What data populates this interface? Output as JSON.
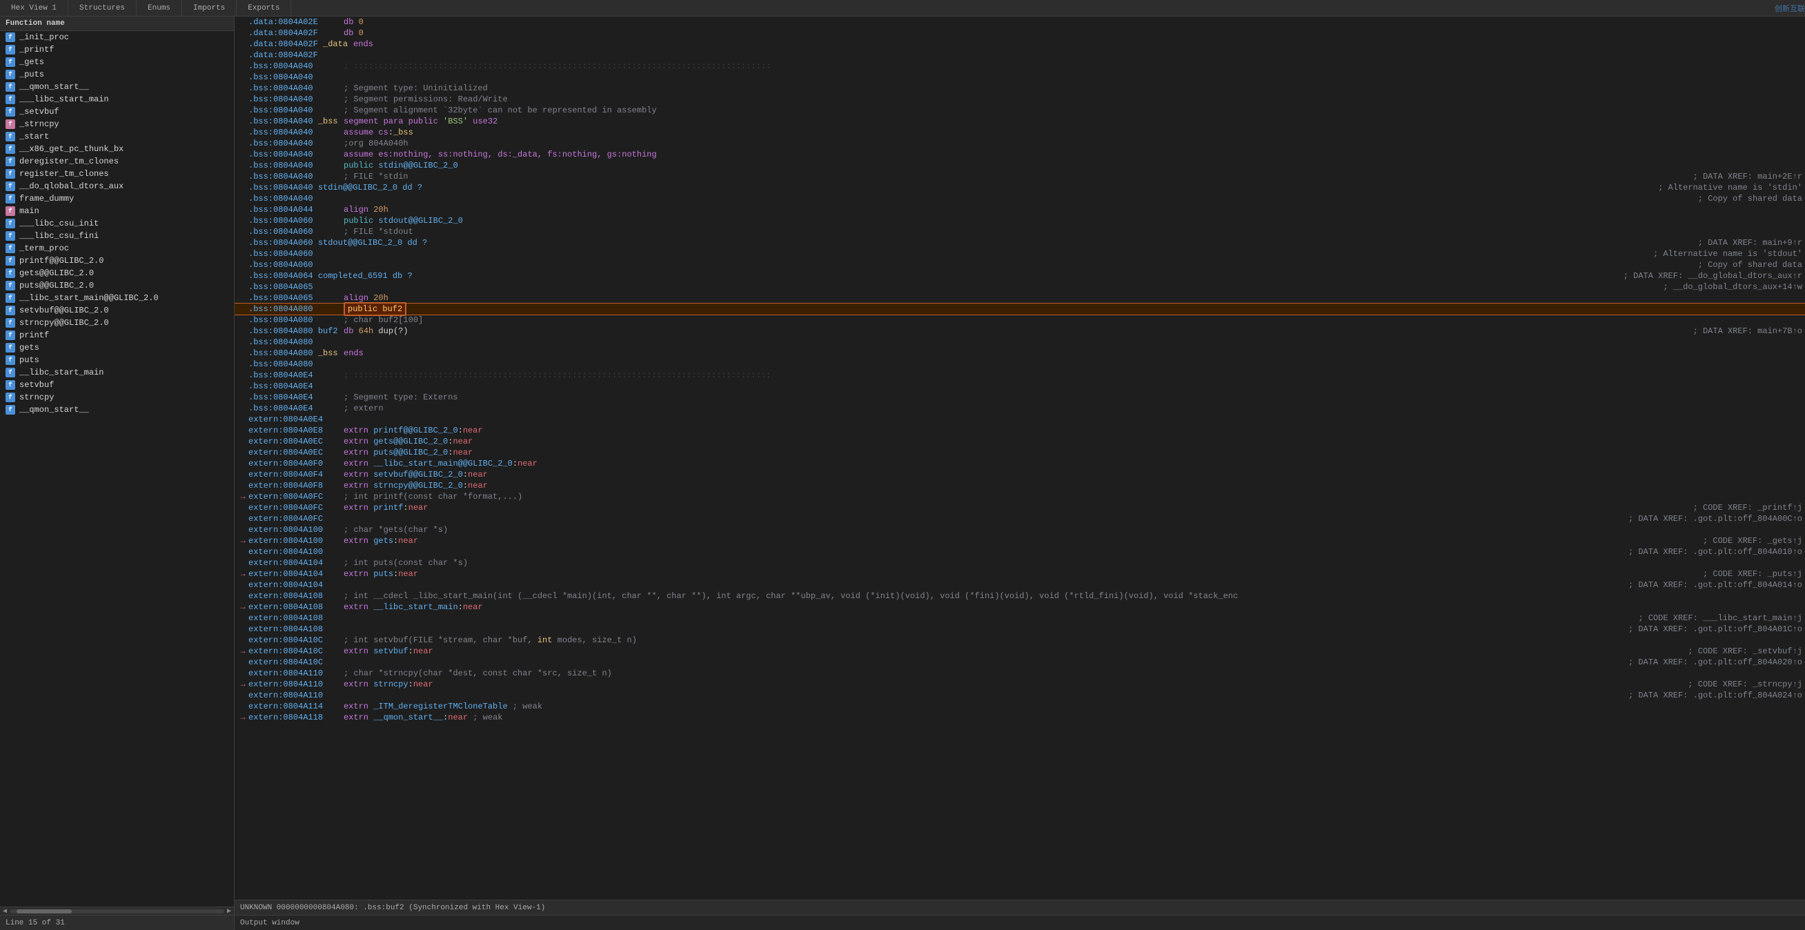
{
  "tabs": [
    {
      "label": "Hex View 1",
      "active": false
    },
    {
      "label": "Structures",
      "active": false
    },
    {
      "label": "Enums",
      "active": false
    },
    {
      "label": "Imports",
      "active": false
    },
    {
      "label": "Exports",
      "active": false
    }
  ],
  "left_panel": {
    "header": "Function name",
    "functions": [
      {
        "name": "_init_proc",
        "icon": "blue",
        "selected": false
      },
      {
        "name": "_printf",
        "icon": "blue",
        "selected": false
      },
      {
        "name": "_gets",
        "icon": "blue",
        "selected": false
      },
      {
        "name": "_puts",
        "icon": "blue",
        "selected": false
      },
      {
        "name": "__qmon_start__",
        "icon": "blue",
        "selected": false
      },
      {
        "name": "___libc_start_main",
        "icon": "blue",
        "selected": false
      },
      {
        "name": "_setvbuf",
        "icon": "blue",
        "selected": false
      },
      {
        "name": "_strncpy",
        "icon": "pink",
        "selected": false
      },
      {
        "name": "_start",
        "icon": "blue",
        "selected": false
      },
      {
        "name": "__x86_get_pc_thunk_bx",
        "icon": "blue",
        "selected": false
      },
      {
        "name": "deregister_tm_clones",
        "icon": "blue",
        "selected": false
      },
      {
        "name": "register_tm_clones",
        "icon": "blue",
        "selected": false
      },
      {
        "name": "__do_qlobal_dtors_aux",
        "icon": "blue",
        "selected": false
      },
      {
        "name": "frame_dummy",
        "icon": "blue",
        "selected": false
      },
      {
        "name": "main",
        "icon": "pink",
        "selected": false
      },
      {
        "name": "___libc_csu_init",
        "icon": "blue",
        "selected": false
      },
      {
        "name": "___libc_csu_fini",
        "icon": "blue",
        "selected": false
      },
      {
        "name": "_term_proc",
        "icon": "blue",
        "selected": false
      },
      {
        "name": "printf@@GLIBC_2.0",
        "icon": "blue",
        "selected": false
      },
      {
        "name": "gets@@GLIBC_2.0",
        "icon": "blue",
        "selected": false
      },
      {
        "name": "puts@@GLIBC_2.0",
        "icon": "blue",
        "selected": false
      },
      {
        "name": "__libc_start_main@@GLIBC_2.0",
        "icon": "blue",
        "selected": false
      },
      {
        "name": "setvbuf@@GLIBC_2.0",
        "icon": "blue",
        "selected": false
      },
      {
        "name": "strncpy@@GLIBC_2.0",
        "icon": "blue",
        "selected": false
      },
      {
        "name": "printf",
        "icon": "blue",
        "selected": false
      },
      {
        "name": "gets",
        "icon": "blue",
        "selected": false
      },
      {
        "name": "puts",
        "icon": "blue",
        "selected": false
      },
      {
        "name": "__libc_start_main",
        "icon": "blue",
        "selected": false
      },
      {
        "name": "setvbuf",
        "icon": "blue",
        "selected": false
      },
      {
        "name": "strncpy",
        "icon": "blue",
        "selected": false
      },
      {
        "name": "__qmon_start__",
        "icon": "blue",
        "selected": false
      }
    ],
    "status": "Line 15 of 31"
  },
  "code_lines": [
    {
      "addr": ".data:0804A02E",
      "content": "db  0",
      "comment": "",
      "arrow": false
    },
    {
      "addr": ".data:0804A02F",
      "content": "db  0",
      "comment": "",
      "arrow": false
    },
    {
      "addr": ".data:0804A02F  _data",
      "content": "ends",
      "comment": "",
      "arrow": false
    },
    {
      "addr": ".data:0804A02F",
      "content": "",
      "comment": "",
      "arrow": false
    },
    {
      "addr": ".bss:0804A040",
      "content": "; ::::::::::::::::::::::::::::::::::::::::::::::::::::::::::::::::::::::::::::::::::::",
      "comment": "",
      "arrow": false
    },
    {
      "addr": ".bss:0804A040",
      "content": "",
      "comment": "",
      "arrow": false
    },
    {
      "addr": ".bss:0804A040",
      "content": "; Segment type: Uninitialized",
      "comment": "",
      "arrow": false
    },
    {
      "addr": ".bss:0804A040",
      "content": "; Segment permissions: Read/Write",
      "comment": "",
      "arrow": false
    },
    {
      "addr": ".bss:0804A040",
      "content": "; Segment alignment `32byte` can not be represented in assembly",
      "comment": "",
      "arrow": false
    },
    {
      "addr": ".bss:0804A040  _bss",
      "content": "segment para public 'BSS' use32",
      "comment": "",
      "arrow": false
    },
    {
      "addr": ".bss:0804A040",
      "content": "assume cs:_bss",
      "comment": "",
      "arrow": false
    },
    {
      "addr": ".bss:0804A040",
      "content": ";org 804A040h",
      "comment": "",
      "arrow": false
    },
    {
      "addr": ".bss:0804A040",
      "content": "assume es:nothing, ss:nothing, ds:_data, fs:nothing, gs:nothing",
      "comment": "",
      "arrow": false
    },
    {
      "addr": ".bss:0804A040",
      "content": "public stdin@@GLIBC_2_0",
      "comment": "",
      "arrow": false
    },
    {
      "addr": ".bss:0804A040",
      "content": "; FILE *stdin",
      "comment": "; DATA XREF: main+2E↑r",
      "arrow": false
    },
    {
      "addr": ".bss:0804A040  stdin@@GLIBC_2_0 dd ?",
      "content": "",
      "comment": "; Alternative name is 'stdin'",
      "arrow": false
    },
    {
      "addr": ".bss:0804A040",
      "content": "",
      "comment": "; Copy of shared data",
      "arrow": false
    },
    {
      "addr": ".bss:0804A044",
      "content": "align 20h",
      "comment": "",
      "arrow": false
    },
    {
      "addr": ".bss:0804A060",
      "content": "public stdout@@GLIBC_2_0",
      "comment": "",
      "arrow": false
    },
    {
      "addr": ".bss:0804A060",
      "content": "; FILE *stdout",
      "comment": "",
      "arrow": false
    },
    {
      "addr": ".bss:0804A060  stdout@@GLIBC_2_0 dd ?",
      "content": "",
      "comment": "; DATA XREF: main+9↑r",
      "arrow": false
    },
    {
      "addr": ".bss:0804A060",
      "content": "",
      "comment": "; Alternative name is 'stdout'",
      "arrow": false
    },
    {
      "addr": ".bss:0804A060",
      "content": "",
      "comment": "; Copy of shared data",
      "arrow": false
    },
    {
      "addr": ".bss:0804A064  completed_6591 db ?",
      "content": "",
      "comment": "; DATA XREF: __do_global_dtors_aux↑r",
      "arrow": false
    },
    {
      "addr": ".bss:0804A065",
      "content": "",
      "comment": "; __do_global_dtors_aux+14↑w",
      "arrow": false
    },
    {
      "addr": ".bss:0804A065",
      "content": "align 20h",
      "comment": "",
      "arrow": false
    },
    {
      "addr": ".bss:0804A080",
      "content": "public buf2",
      "comment": "",
      "arrow": false,
      "highlighted": true
    },
    {
      "addr": ".bss:0804A080",
      "content": "; char buf2[100]",
      "comment": "",
      "arrow": false
    },
    {
      "addr": ".bss:0804A080  buf2",
      "content": "db 64h dup(?)",
      "comment": "; DATA XREF: main+7B↑o",
      "arrow": false
    },
    {
      "addr": ".bss:0804A080",
      "content": "",
      "comment": "",
      "arrow": false
    },
    {
      "addr": ".bss:0804A080  _bss",
      "content": "ends",
      "comment": "",
      "arrow": false
    },
    {
      "addr": ".bss:0804A080",
      "content": "",
      "comment": "",
      "arrow": false
    },
    {
      "addr": ".bss:0804A0E4",
      "content": "; ::::::::::::::::::::::::::::::::::::::::::::::::::::::::::::::::::::::::::::::::::::",
      "comment": "",
      "arrow": false
    },
    {
      "addr": ".bss:0804A0E4",
      "content": "",
      "comment": "",
      "arrow": false
    },
    {
      "addr": ".bss:0804A0E4",
      "content": "; Segment type: Externs",
      "comment": "",
      "arrow": false
    },
    {
      "addr": ".bss:0804A0E4",
      "content": "; extern",
      "comment": "",
      "arrow": false
    },
    {
      "addr": "extern:0804A0E4",
      "content": "",
      "comment": "",
      "arrow": false
    },
    {
      "addr": "extern:0804A0E8",
      "content": "extrn printf@@GLIBC_2_0:near",
      "comment": "",
      "arrow": false
    },
    {
      "addr": "extern:0804A0EC",
      "content": "extrn gets@@GLIBC_2_0:near",
      "comment": "",
      "arrow": false
    },
    {
      "addr": "extern:0804A0EC",
      "content": "extrn puts@@GLIBC_2_0:near",
      "comment": "",
      "arrow": false
    },
    {
      "addr": "extern:0804A0F0",
      "content": "extrn __libc_start_main@@GLIBC_2_0:near",
      "comment": "",
      "arrow": false
    },
    {
      "addr": "extern:0804A0F4",
      "content": "extrn setvbuf@@GLIBC_2_0:near",
      "comment": "",
      "arrow": false
    },
    {
      "addr": "extern:0804A0F8",
      "content": "extrn strncpy@@GLIBC_2_0:near",
      "comment": "",
      "arrow": false
    },
    {
      "addr": "extern:0804A0FC",
      "content": "; int printf(const char *format,...)",
      "comment": "",
      "arrow": true
    },
    {
      "addr": "extern:0804A0FC",
      "content": "extrn printf:near",
      "comment": "; CODE XREF: _printf↑j",
      "arrow": false
    },
    {
      "addr": "extern:0804A0FC",
      "content": "",
      "comment": "; DATA XREF: .got.plt:off_804A00C↑o",
      "arrow": false
    },
    {
      "addr": "extern:0804A100",
      "content": "; char *gets(char *s)",
      "comment": "",
      "arrow": true
    },
    {
      "addr": "extern:0804A100",
      "content": "extrn gets:near",
      "comment": "; CODE XREF: _gets↑j",
      "arrow": false
    },
    {
      "addr": "extern:0804A100",
      "content": "",
      "comment": "; DATA XREF: .got.plt:off_804A010↑o",
      "arrow": false
    },
    {
      "addr": "extern:0804A104",
      "content": "; int puts(const char *s)",
      "comment": "",
      "arrow": true
    },
    {
      "addr": "extern:0804A104",
      "content": "extrn puts:near",
      "comment": "; CODE XREF: _puts↑j",
      "arrow": false
    },
    {
      "addr": "extern:0804A104",
      "content": "",
      "comment": "; DATA XREF: .got.plt:off_804A014↑o",
      "arrow": false
    },
    {
      "addr": "extern:0804A108",
      "content": "; int __cdecl _libc_start_main(int (__cdecl *main)(int, char **, char **), int argc, char **ubp_av, void (*init)(void), void (*fini)(void), void (*rtld_fini)(void), void *stack_enc",
      "comment": "",
      "arrow": true
    },
    {
      "addr": "extern:0804A108",
      "content": "extrn __libc_start_main:near",
      "comment": "",
      "arrow": false
    },
    {
      "addr": "extern:0804A108",
      "content": "",
      "comment": "; CODE XREF: ___libc_start_main↑j",
      "arrow": false
    },
    {
      "addr": "extern:0804A108",
      "content": "",
      "comment": "; DATA XREF: .got.plt:off_804A01C↑o",
      "arrow": false
    },
    {
      "addr": "extern:0804A10C",
      "content": "; int setvbuf(FILE *stream, char *buf, int modes, size_t n)",
      "comment": "",
      "arrow": true
    },
    {
      "addr": "extern:0804A10C",
      "content": "extrn setvbuf:near",
      "comment": "; CODE XREF: _setvbuf↑j",
      "arrow": false
    },
    {
      "addr": "extern:0804A10C",
      "content": "",
      "comment": "; DATA XREF: .got.plt:off_804A020↑o",
      "arrow": false
    },
    {
      "addr": "extern:0804A110",
      "content": "; char *strncpy(char *dest, const char *src, size_t n)",
      "comment": "",
      "arrow": true
    },
    {
      "addr": "extern:0804A110",
      "content": "extrn strncpy:near",
      "comment": "; CODE XREF: _strncpy↑j",
      "arrow": false
    },
    {
      "addr": "extern:0804A110",
      "content": "",
      "comment": "; DATA XREF: .got.plt:off_804A024↑o",
      "arrow": false
    },
    {
      "addr": "extern:0804A114",
      "content": "extrn _ITM_deregisterTMCloneTable ; weak",
      "comment": "",
      "arrow": false
    },
    {
      "addr": "extern:0804A118",
      "content": "extrn __qmon_start__:near ; weak",
      "comment": "",
      "arrow": false
    }
  ],
  "status_bar": {
    "text": "UNKNOWN 0000000000804A080:  .bss:buf2 (Synchronized with Hex View-1)"
  },
  "output_window": {
    "label": "Output window"
  },
  "logo": "创新互联"
}
